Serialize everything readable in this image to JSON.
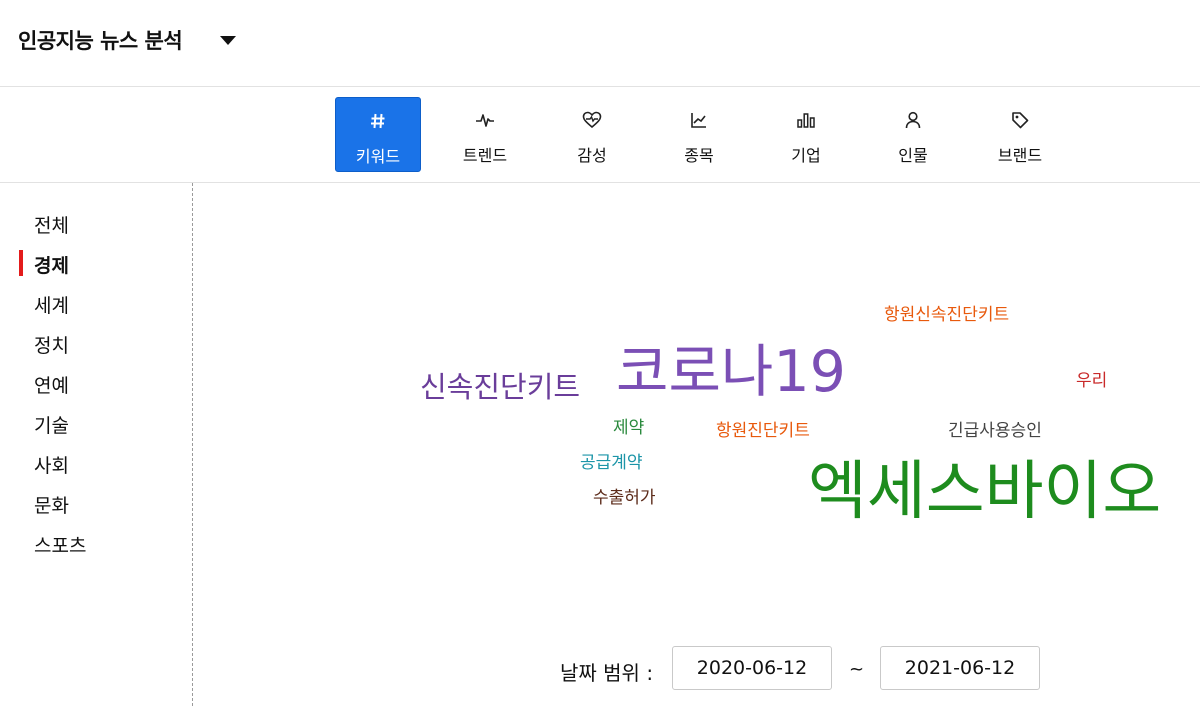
{
  "header": {
    "title": "인공지능 뉴스 분석",
    "dropdown_icon": "caret-down-icon"
  },
  "tabs": [
    {
      "label": "키워드",
      "icon": "hash-icon",
      "active": true
    },
    {
      "label": "트렌드",
      "icon": "pulse-icon",
      "active": false
    },
    {
      "label": "감성",
      "icon": "heart-pulse-icon",
      "active": false
    },
    {
      "label": "종목",
      "icon": "line-chart-icon",
      "active": false
    },
    {
      "label": "기업",
      "icon": "bar-chart-icon",
      "active": false
    },
    {
      "label": "인물",
      "icon": "user-icon",
      "active": false
    },
    {
      "label": "브랜드",
      "icon": "tag-icon",
      "active": false
    }
  ],
  "sidebar": {
    "items": [
      {
        "label": "전체",
        "active": false
      },
      {
        "label": "경제",
        "active": true
      },
      {
        "label": "세계",
        "active": false
      },
      {
        "label": "정치",
        "active": false
      },
      {
        "label": "연예",
        "active": false
      },
      {
        "label": "기술",
        "active": false
      },
      {
        "label": "사회",
        "active": false
      },
      {
        "label": "문화",
        "active": false
      },
      {
        "label": "스포츠",
        "active": false
      }
    ],
    "active_marker_color": "#e31b1b"
  },
  "wordcloud": {
    "words": [
      {
        "text": "항원신속진단키트",
        "color": "#e8590c"
      },
      {
        "text": "코로나19",
        "color": "#7b4fb5"
      },
      {
        "text": "신속진단키트",
        "color": "#6a3d9a"
      },
      {
        "text": "우리",
        "color": "#c92a2a"
      },
      {
        "text": "제약",
        "color": "#2b8a3e"
      },
      {
        "text": "항원진단키트",
        "color": "#e8590c"
      },
      {
        "text": "긴급사용승인",
        "color": "#444444"
      },
      {
        "text": "공급계약",
        "color": "#1c95a8"
      },
      {
        "text": "수출허가",
        "color": "#5c2b1a"
      },
      {
        "text": "엑세스바이오",
        "color": "#1e8c1e"
      }
    ]
  },
  "daterange": {
    "label": "날짜 범위 :",
    "start": "2020-06-12",
    "separator": "~",
    "end": "2021-06-12"
  },
  "colors": {
    "accent": "#1a73e8",
    "active_marker": "#e31b1b"
  }
}
